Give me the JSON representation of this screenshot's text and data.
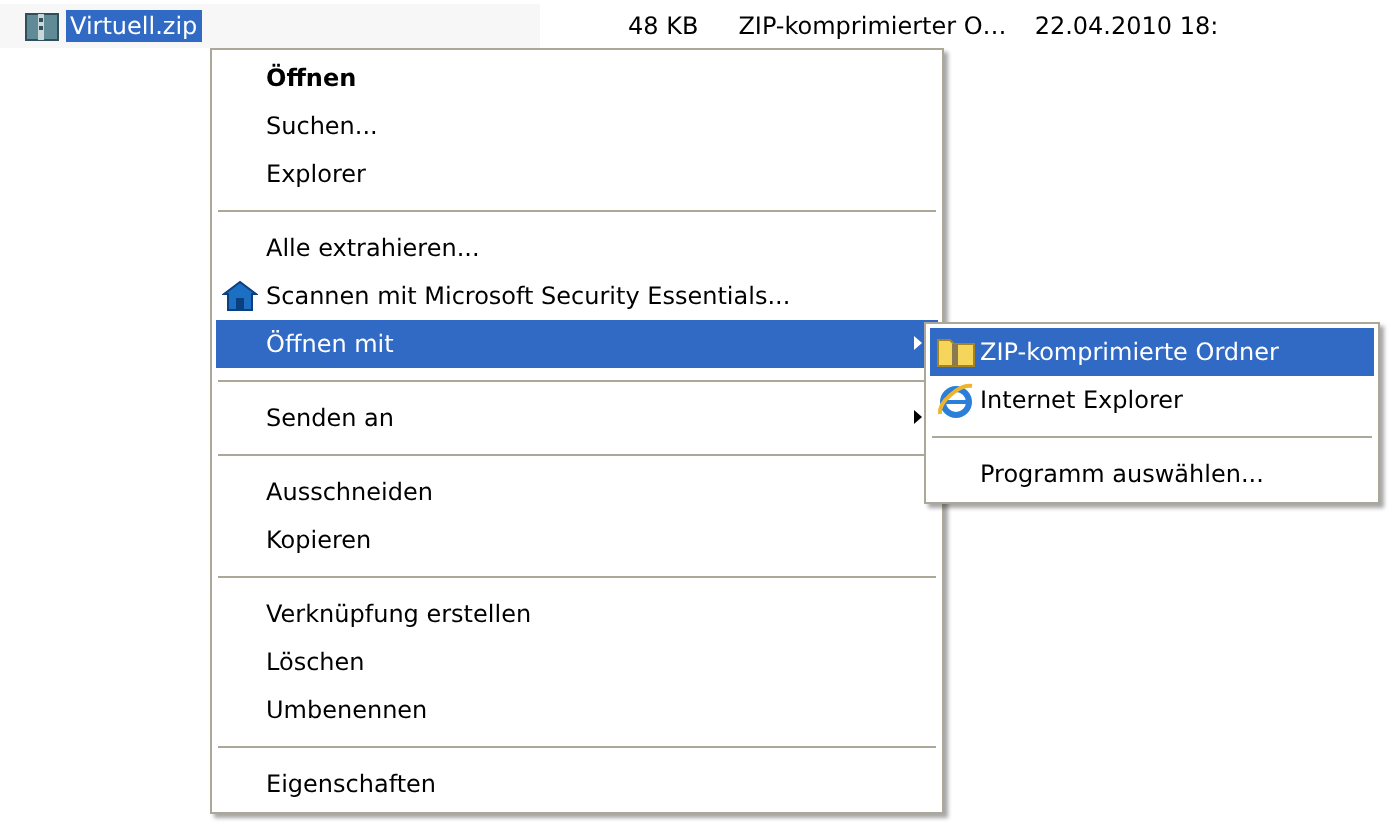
{
  "file_row": {
    "name": "Virtuell.zip",
    "selected": true,
    "size": "48 KB",
    "type": "ZIP-komprimierter O…",
    "date": "22.04.2010 18:"
  },
  "context_menu": {
    "items": [
      {
        "kind": "item",
        "label": "Öffnen",
        "default": true,
        "selected": false,
        "submenu": false,
        "icon": false
      },
      {
        "kind": "item",
        "label": "Suchen...",
        "default": false,
        "selected": false,
        "submenu": false,
        "icon": false
      },
      {
        "kind": "item",
        "label": "Explorer",
        "default": false,
        "selected": false,
        "submenu": false,
        "icon": false
      },
      {
        "kind": "separator"
      },
      {
        "kind": "item",
        "label": "Alle extrahieren...",
        "default": false,
        "selected": false,
        "submenu": false,
        "icon": false
      },
      {
        "kind": "item",
        "label": "Scannen mit Microsoft Security Essentials...",
        "default": false,
        "selected": false,
        "submenu": false,
        "icon": true
      },
      {
        "kind": "item",
        "label": "Öffnen mit",
        "default": false,
        "selected": true,
        "submenu": true,
        "icon": false
      },
      {
        "kind": "separator"
      },
      {
        "kind": "item",
        "label": "Senden an",
        "default": false,
        "selected": false,
        "submenu": true,
        "icon": false
      },
      {
        "kind": "separator"
      },
      {
        "kind": "item",
        "label": "Ausschneiden",
        "default": false,
        "selected": false,
        "submenu": false,
        "icon": false
      },
      {
        "kind": "item",
        "label": "Kopieren",
        "default": false,
        "selected": false,
        "submenu": false,
        "icon": false
      },
      {
        "kind": "separator"
      },
      {
        "kind": "item",
        "label": "Verknüpfung erstellen",
        "default": false,
        "selected": false,
        "submenu": false,
        "icon": false
      },
      {
        "kind": "item",
        "label": "Löschen",
        "default": false,
        "selected": false,
        "submenu": false,
        "icon": false
      },
      {
        "kind": "item",
        "label": "Umbenennen",
        "default": false,
        "selected": false,
        "submenu": false,
        "icon": false
      },
      {
        "kind": "separator"
      },
      {
        "kind": "item",
        "label": "Eigenschaften",
        "default": false,
        "selected": false,
        "submenu": false,
        "icon": false
      }
    ]
  },
  "submenu": {
    "items": [
      {
        "kind": "item",
        "label": "ZIP-komprimierte Ordner",
        "selected": true
      },
      {
        "kind": "item",
        "label": "Internet Explorer",
        "selected": false
      },
      {
        "kind": "separator"
      },
      {
        "kind": "item",
        "label": "Programm auswählen...",
        "selected": false
      }
    ]
  }
}
